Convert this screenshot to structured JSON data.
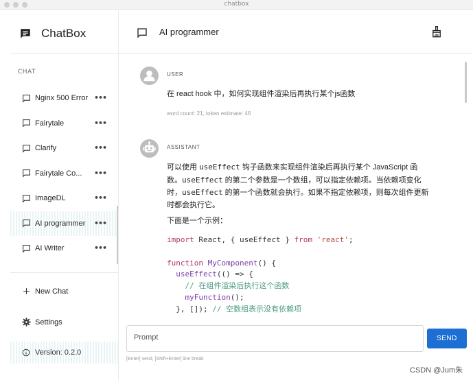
{
  "window": {
    "title": "chatbox"
  },
  "brand": {
    "name": "ChatBox"
  },
  "sidebar": {
    "section_label": "CHAT",
    "items": [
      {
        "label": "Nginx 500 Error",
        "active": false
      },
      {
        "label": "Fairytale",
        "active": false
      },
      {
        "label": "Clarify",
        "active": false
      },
      {
        "label": "Fairytale Co...",
        "active": false
      },
      {
        "label": "ImageDL",
        "active": false
      },
      {
        "label": "AI programmer",
        "active": true
      },
      {
        "label": "AI Writer",
        "active": false
      }
    ],
    "more_glyph": "•••",
    "new_chat_label": "New Chat",
    "settings_label": "Settings",
    "version_label": "Version: 0.2.0"
  },
  "header": {
    "title": "AI programmer"
  },
  "messages": {
    "user_role": "USER",
    "user_text": "在 react hook 中，如何实现组件渲染后再执行某个js函数",
    "user_meta": "word count: 21, token estimate: 46",
    "assistant_role": "ASSISTANT",
    "assistant_p1": {
      "a": "可以使用 ",
      "code1": "useEffect",
      "b": " 钩子函数来实现组件渲染后再执行某个 JavaScript 函数。",
      "code2": "useEffect",
      "c": " 的第二个参数是一个数组，可以指定依赖项。当依赖项变化时，",
      "code3": "useEffect",
      "d": " 的第一个函数就会执行。如果不指定依赖项，则每次组件更新时都会执行它。"
    },
    "assistant_p2": "下面是一个示例：",
    "code": {
      "l1_kw": "import",
      "l1_mid": " React, { useEffect } ",
      "l1_from": "from",
      "l1_str": "'react'",
      "l1_end": ";",
      "l3_kw": "function",
      "l3_fn": "MyComponent",
      "l3_end": "() {",
      "l4_fn": "useEffect",
      "l4_end": "(() => {",
      "l5_cm": "// 在组件渲染后执行这个函数",
      "l6_fn": "myFunction",
      "l6_end": "();",
      "l7_a": "}, []); ",
      "l7_cm": "// 空数组表示没有依赖项"
    }
  },
  "composer": {
    "placeholder": "Prompt",
    "send_label": "SEND",
    "hint": "[Enter] send, [Shift+Enter] line break"
  },
  "watermark": "CSDN @Jum朱",
  "colors": {
    "accent": "#1e6fd3",
    "active_bg": "#e9f4f7",
    "keyword": "#b0366b",
    "comment": "#4e9b86"
  },
  "icons": {
    "brand": "chat-bubble-icon",
    "chat": "chat-outline-icon",
    "new_chat": "plus-icon",
    "settings": "gear-icon",
    "version": "info-icon",
    "clean": "broom-icon",
    "user_avatar": "person-icon",
    "assistant_avatar": "robot-icon"
  }
}
